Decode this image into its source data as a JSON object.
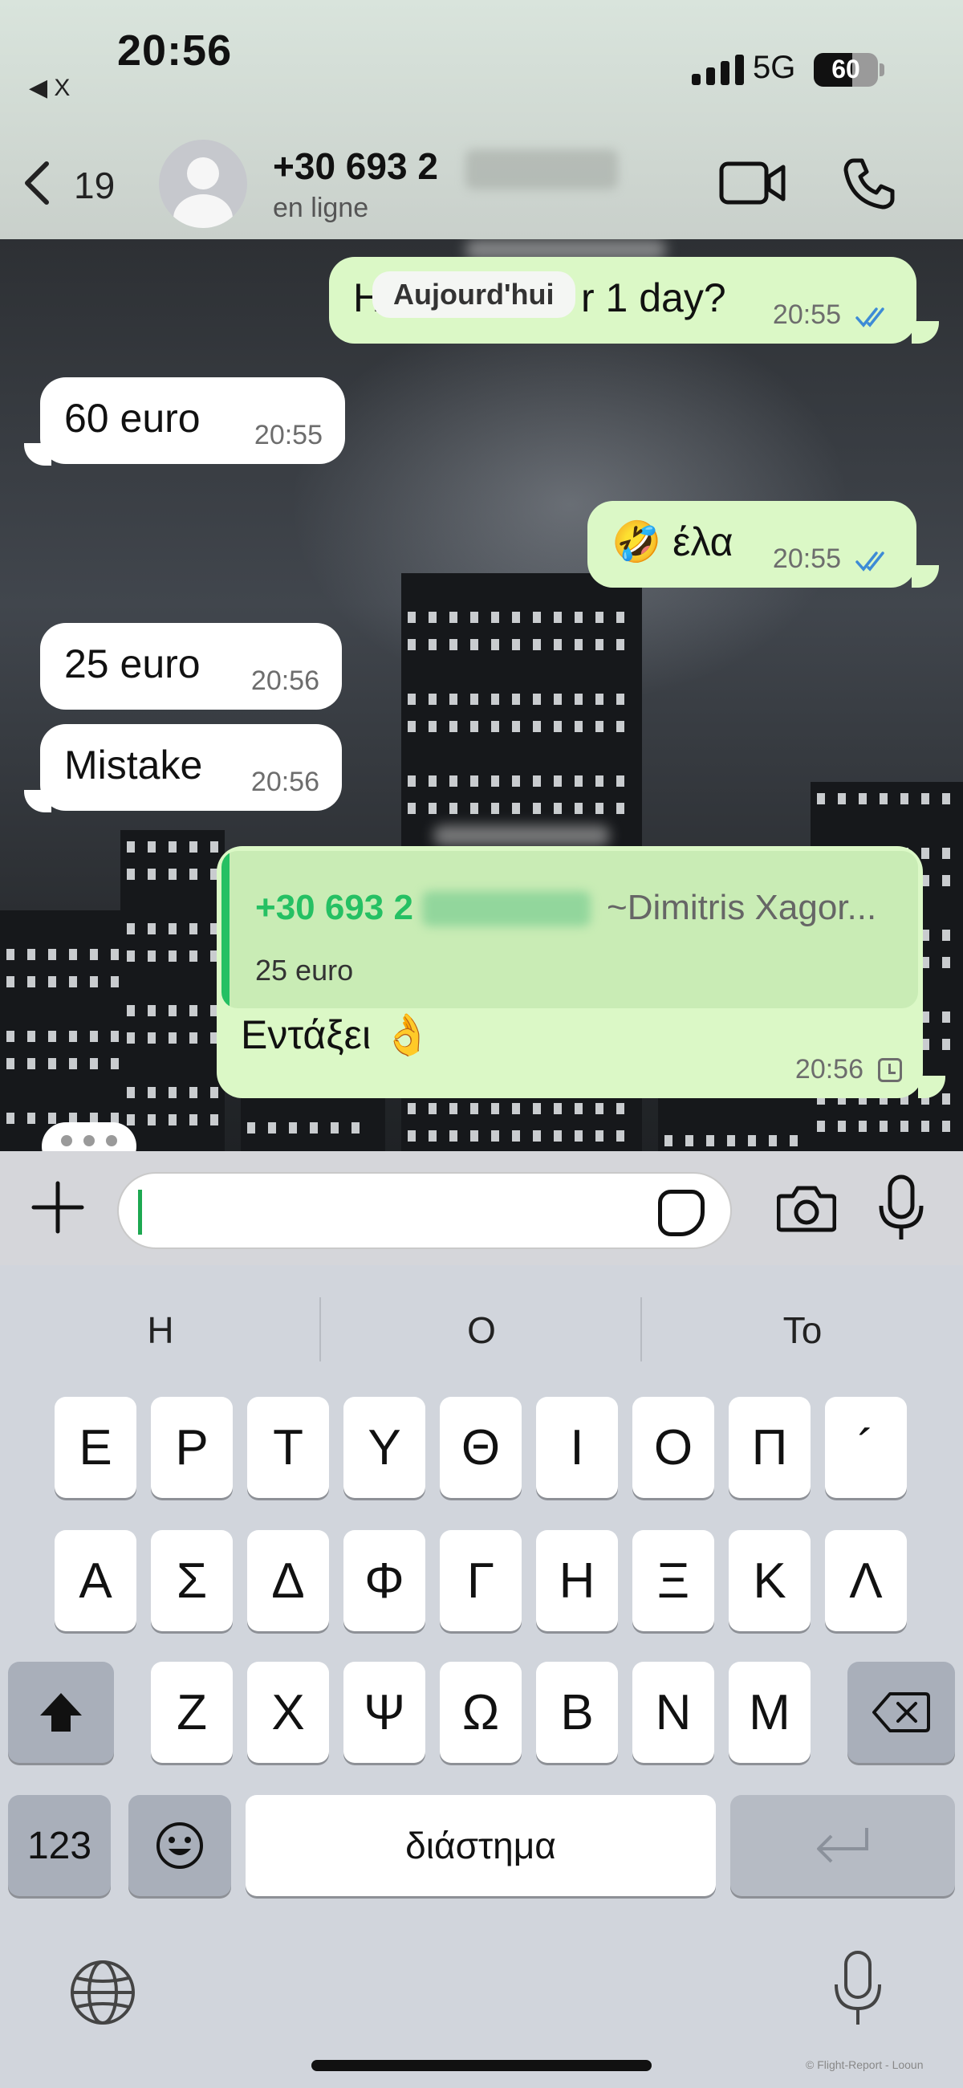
{
  "status_bar": {
    "time": "20:56",
    "back_app": "◀ X",
    "network": "5G",
    "battery": "60",
    "battery_level": 0.6
  },
  "header": {
    "unread_count": "19",
    "contact_name": "+30 693 2",
    "contact_status": "en ligne",
    "icons": [
      "back-chevron-icon",
      "avatar-placeholder-icon",
      "video-call-icon",
      "phone-call-icon"
    ]
  },
  "chat": {
    "day_separator": "Aujourd'hui",
    "messages": [
      {
        "direction": "out",
        "text_left": "H",
        "text_right": "r 1 day?",
        "time": "20:55",
        "status": "read"
      },
      {
        "direction": "in",
        "text": "60 euro",
        "time": "20:55"
      },
      {
        "direction": "out",
        "text": "🤣 έλα",
        "time": "20:55",
        "status": "read"
      },
      {
        "direction": "in",
        "text": "25 euro",
        "time": "20:56"
      },
      {
        "direction": "in",
        "text": "Mistake",
        "time": "20:56"
      },
      {
        "direction": "out",
        "text": "Εντάξει 👌",
        "time": "20:56",
        "status": "pending",
        "quote": {
          "name": "+30 693 2",
          "pushname": "~Dimitris Xagor...",
          "text": "25 euro"
        }
      }
    ]
  },
  "composer": {
    "placeholder": "",
    "icons": [
      "plus-icon",
      "sticker-icon",
      "camera-icon",
      "microphone-icon"
    ]
  },
  "keyboard": {
    "suggestions": [
      "Η",
      "Ο",
      "Το"
    ],
    "row1": [
      "Ε",
      "Ρ",
      "Τ",
      "Υ",
      "Θ",
      "Ι",
      "Ο",
      "Π",
      "´"
    ],
    "row2": [
      "Α",
      "Σ",
      "Δ",
      "Φ",
      "Γ",
      "Η",
      "Ξ",
      "Κ",
      "Λ"
    ],
    "row3": [
      "Ζ",
      "Χ",
      "Ψ",
      "Ω",
      "Β",
      "Ν",
      "Μ"
    ],
    "numbers_key": "123",
    "space_key": "διάστημα",
    "icons": [
      "shift-icon",
      "backspace-icon",
      "emoji-icon",
      "return-icon",
      "globe-icon",
      "dictation-icon"
    ]
  },
  "watermark": "© Flight-Report - Looun",
  "colors": {
    "outgoing_bubble": "#dbf8c6",
    "incoming_bubble": "#ffffff",
    "accent_green": "#25c063",
    "read_ticks": "#3d8bd6"
  }
}
